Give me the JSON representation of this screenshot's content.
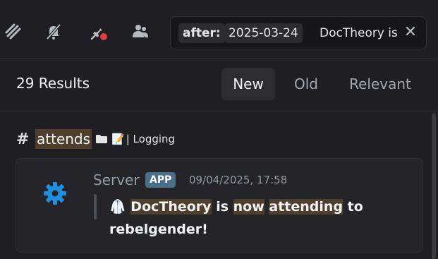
{
  "toolbar": {
    "icons": [
      "threads-icon",
      "mute-bell-icon",
      "pin-icon",
      "members-icon"
    ],
    "search": {
      "filter_key": "after:",
      "filter_value": "2025-03-24",
      "query": "DocTheory is",
      "clear_glyph": "✕"
    }
  },
  "results": {
    "count_label": "29 Results",
    "sort_tabs": [
      {
        "label": "New",
        "active": true
      },
      {
        "label": "Old",
        "active": false
      },
      {
        "label": "Relevant",
        "active": false
      }
    ]
  },
  "channel": {
    "hash": "#",
    "name": "attends",
    "subtitle": "| Logging"
  },
  "message": {
    "author": "Server",
    "badge": "APP",
    "timestamp": "09/04/2025, 17:58",
    "line1": {
      "emoji": "🥼",
      "parts": [
        "DocTheory",
        " is ",
        "now",
        " ",
        "attending",
        " to"
      ]
    },
    "line2": "rebelgender!"
  },
  "colors": {
    "background": "#1f1f23",
    "highlight": "#4e3e2c",
    "app_badge": "#4a6f8a",
    "gear_blue": "#1e8fe0",
    "pin_dot": "#e03c3c"
  }
}
